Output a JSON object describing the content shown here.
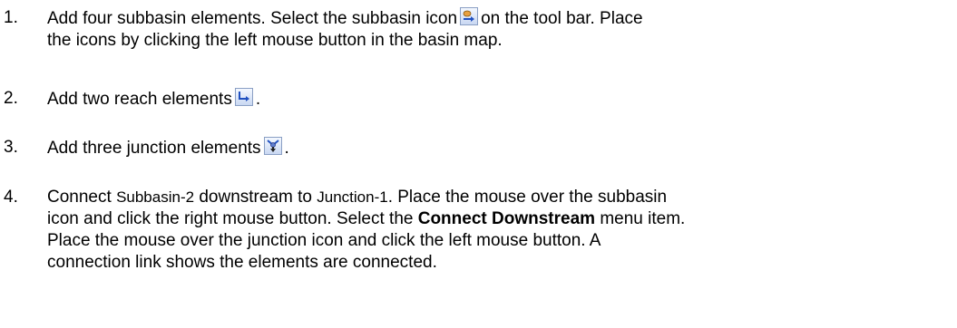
{
  "steps": [
    {
      "number": "1.",
      "part1": "Add four subbasin elements.  Select the subbasin icon",
      "icon": "subbasin-icon",
      "part2": "on the tool bar.  Place",
      "line2": "the icons by clicking the left mouse button in the basin map."
    },
    {
      "number": "2.",
      "part1": "Add two reach elements",
      "icon": "reach-icon",
      "part2": "."
    },
    {
      "number": "3.",
      "part1": "Add three junction elements",
      "icon": "junction-icon",
      "part2": "."
    },
    {
      "number": "4.",
      "part1": "Connect",
      "subbasin_name": "Subbasin-2",
      "part2": "downstream to",
      "junction_name": "Junction-1",
      "part3": ".  Place the mouse over the subbasin",
      "line2": "icon and click the right mouse button.  Select the",
      "menu_item": "Connect Downstream",
      "line2_end": "menu item.",
      "line3": "Place the mouse over the junction icon and click the left mouse button.  A",
      "line4": "connection link shows the elements are connected."
    }
  ]
}
